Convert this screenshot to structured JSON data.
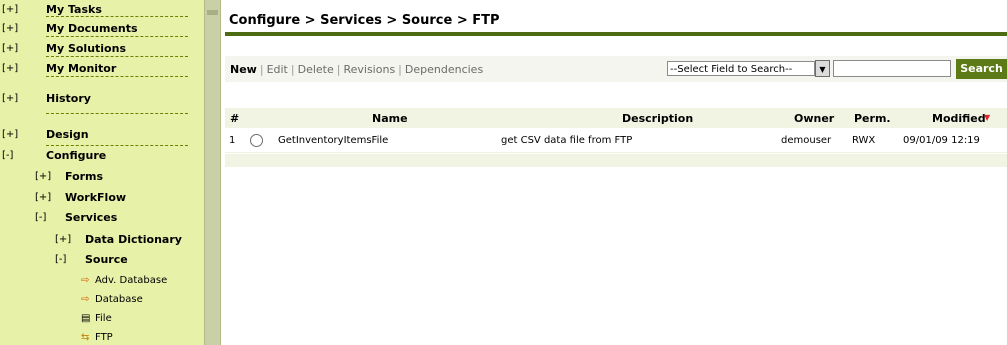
{
  "sidebar": {
    "top_items": [
      {
        "toggle": "[+]",
        "label": "My Tasks"
      },
      {
        "toggle": "[+]",
        "label": "My Documents"
      },
      {
        "toggle": "[+]",
        "label": "My Solutions"
      },
      {
        "toggle": "[+]",
        "label": "My Monitor"
      },
      {
        "toggle": "[+]",
        "label": "History"
      },
      {
        "toggle": "[+]",
        "label": "Design"
      },
      {
        "toggle": "[-]",
        "label": "Configure"
      }
    ],
    "configure_items": [
      {
        "toggle": "[+]",
        "label": "Forms"
      },
      {
        "toggle": "[+]",
        "label": "WorkFlow"
      },
      {
        "toggle": "[-]",
        "label": "Services"
      }
    ],
    "services_items": [
      {
        "toggle": "[+]",
        "label": "Data Dictionary"
      },
      {
        "toggle": "[-]",
        "label": "Source"
      }
    ],
    "source_items": [
      {
        "icon": "database-adv-icon",
        "label": "Adv. Database"
      },
      {
        "icon": "database-icon",
        "label": "Database"
      },
      {
        "icon": "file-icon",
        "label": "File"
      },
      {
        "icon": "ftp-icon",
        "label": "FTP"
      }
    ]
  },
  "main": {
    "title": "Configure > Services > Source > FTP",
    "toolbar": {
      "new": "New",
      "edit": "Edit",
      "delete": "Delete",
      "revisions": "Revisions",
      "dependencies": "Dependencies",
      "separator": "|",
      "field_select": "--Select Field to Search--",
      "search_value": "",
      "search_button": "Search"
    },
    "table": {
      "headers": {
        "num": "#",
        "name": "Name",
        "description": "Description",
        "owner": "Owner",
        "perm": "Perm.",
        "modified": "Modified"
      },
      "sort_indicator": "▼",
      "rows": [
        {
          "num": "1",
          "name": "GetInventoryItemsFile",
          "description": "get CSV data file from FTP",
          "owner": "demouser",
          "perm": "RWX",
          "modified": "09/01/09 12:19"
        }
      ]
    }
  },
  "colors": {
    "sidebar_bg": "#e8f1a8",
    "accent_green": "#4c6b13",
    "search_button": "#5c7a16",
    "sort_arrow": "#e0282c"
  }
}
